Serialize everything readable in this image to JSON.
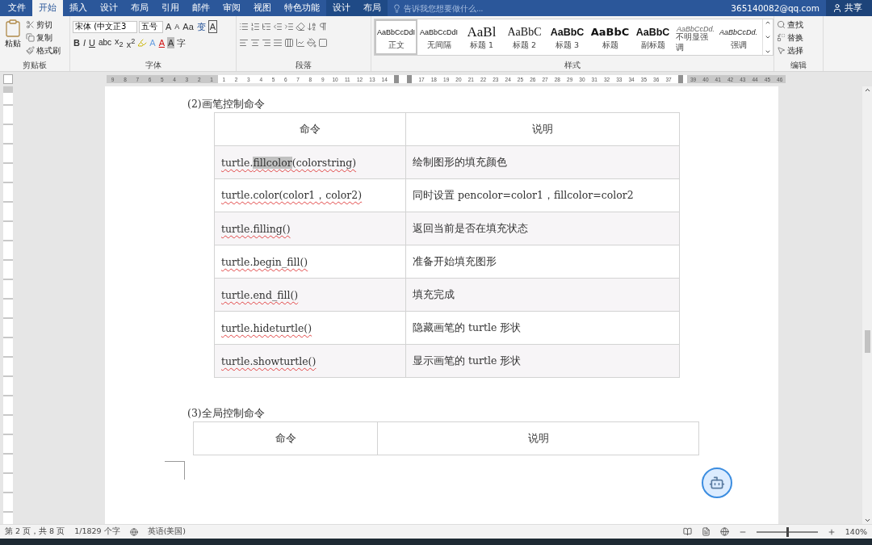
{
  "tabs": [
    {
      "label": "文件",
      "selected": false,
      "kind": "main"
    },
    {
      "label": "开始",
      "selected": true,
      "kind": "main"
    },
    {
      "label": "插入",
      "selected": false,
      "kind": "main"
    },
    {
      "label": "设计",
      "selected": false,
      "kind": "main"
    },
    {
      "label": "布局",
      "selected": false,
      "kind": "main"
    },
    {
      "label": "引用",
      "selected": false,
      "kind": "main"
    },
    {
      "label": "邮件",
      "selected": false,
      "kind": "main"
    },
    {
      "label": "审阅",
      "selected": false,
      "kind": "main"
    },
    {
      "label": "视图",
      "selected": false,
      "kind": "main"
    },
    {
      "label": "特色功能",
      "selected": false,
      "kind": "main"
    },
    {
      "label": "设计",
      "selected": false,
      "kind": "context"
    },
    {
      "label": "布局",
      "selected": false,
      "kind": "context"
    }
  ],
  "tell_me": {
    "placeholder": "告诉我您想要做什么..."
  },
  "account": "365140082@qq.com",
  "share": "共享",
  "clipboard": {
    "paste": "粘贴",
    "items": [
      "剪切",
      "复制",
      "格式刷"
    ],
    "label": "剪贴板"
  },
  "font": {
    "name": "宋体 (中文正3",
    "size": "五号",
    "row1": [
      "A",
      "A",
      "Aa",
      "变",
      "A"
    ],
    "row2": [
      "B",
      "I",
      "U",
      "abc",
      "x$_{2}$",
      "x$^{2}$"
    ],
    "row2b": [
      "A",
      "A",
      "A",
      "字"
    ],
    "label": "字体"
  },
  "paragraph": {
    "label": "段落"
  },
  "styles": {
    "label": "样式",
    "items": [
      {
        "preview": "AaBbCcDdI",
        "name": "正文",
        "selected": true,
        "kind": "body"
      },
      {
        "preview": "AaBbCcDdI",
        "name": "无间隔",
        "selected": false,
        "kind": "body"
      },
      {
        "preview": "AaBl",
        "name": "标题 1",
        "selected": false,
        "kind": "h1"
      },
      {
        "preview": "AaBbC",
        "name": "标题 2",
        "selected": false,
        "kind": "h2"
      },
      {
        "preview": "AaBbC",
        "name": "标题 3",
        "selected": false,
        "kind": "h3"
      },
      {
        "preview": "AaBbC",
        "name": "标题",
        "selected": false,
        "kind": "title"
      },
      {
        "preview": "AaBbC",
        "name": "副标题",
        "selected": false,
        "kind": "subtitle"
      },
      {
        "preview": "AaBbCcDd.",
        "name": "不明显强调",
        "selected": false,
        "kind": "subtle"
      },
      {
        "preview": "AaBbCcDd.",
        "name": "强调",
        "selected": false,
        "kind": "emphasis"
      }
    ]
  },
  "editing": {
    "label": "编辑",
    "items": [
      "查找",
      "替换",
      "选择"
    ]
  },
  "ruler": [
    {
      "label": "9",
      "kind": "margin"
    },
    {
      "label": "8",
      "kind": "margin"
    },
    {
      "label": "7",
      "kind": "margin"
    },
    {
      "label": "6",
      "kind": "margin"
    },
    {
      "label": "5",
      "kind": "margin"
    },
    {
      "label": "4",
      "kind": "margin"
    },
    {
      "label": "3",
      "kind": "margin"
    },
    {
      "label": "2",
      "kind": "margin"
    },
    {
      "label": "1",
      "kind": "margin"
    },
    {
      "label": "1",
      "kind": "text"
    },
    {
      "label": "2",
      "kind": "text"
    },
    {
      "label": "3",
      "kind": "text"
    },
    {
      "label": "4",
      "kind": "text"
    },
    {
      "label": "5",
      "kind": "text"
    },
    {
      "label": "6",
      "kind": "text"
    },
    {
      "label": "7",
      "kind": "text"
    },
    {
      "label": "8",
      "kind": "text"
    },
    {
      "label": "9",
      "kind": "text"
    },
    {
      "label": "10",
      "kind": "text"
    },
    {
      "label": "11",
      "kind": "text"
    },
    {
      "label": "12",
      "kind": "text"
    },
    {
      "label": "13",
      "kind": "text"
    },
    {
      "label": "14",
      "kind": "text"
    },
    {
      "kind": "marker"
    },
    {
      "kind": "marker"
    },
    {
      "label": "17",
      "kind": "text"
    },
    {
      "label": "18",
      "kind": "text"
    },
    {
      "label": "19",
      "kind": "text"
    },
    {
      "label": "20",
      "kind": "text"
    },
    {
      "label": "21",
      "kind": "text"
    },
    {
      "label": "22",
      "kind": "text"
    },
    {
      "label": "23",
      "kind": "text"
    },
    {
      "label": "24",
      "kind": "text"
    },
    {
      "label": "25",
      "kind": "text"
    },
    {
      "label": "26",
      "kind": "text"
    },
    {
      "label": "27",
      "kind": "text"
    },
    {
      "label": "28",
      "kind": "text"
    },
    {
      "label": "29",
      "kind": "text"
    },
    {
      "label": "30",
      "kind": "text"
    },
    {
      "label": "31",
      "kind": "text"
    },
    {
      "label": "32",
      "kind": "text"
    },
    {
      "label": "33",
      "kind": "text"
    },
    {
      "label": "34",
      "kind": "text"
    },
    {
      "label": "35",
      "kind": "text"
    },
    {
      "label": "36",
      "kind": "text"
    },
    {
      "label": "37",
      "kind": "text"
    },
    {
      "kind": "marker"
    },
    {
      "label": "39",
      "kind": "margin"
    },
    {
      "label": "40",
      "kind": "margin"
    },
    {
      "label": "41",
      "kind": "margin"
    },
    {
      "label": "42",
      "kind": "margin"
    },
    {
      "label": "43",
      "kind": "margin"
    },
    {
      "label": "44",
      "kind": "margin"
    },
    {
      "label": "45",
      "kind": "margin"
    },
    {
      "label": "46",
      "kind": "margin"
    }
  ],
  "document": {
    "heading1": "(2)画笔控制命令",
    "table1": {
      "columns": [
        "命令",
        "说明"
      ],
      "rows": [
        {
          "command": [
            {
              "text": "turtle.",
              "selected": false
            },
            {
              "text": "fillcolor",
              "selected": true
            },
            {
              "text": "(colorstring)",
              "selected": false
            }
          ],
          "description": "绘制图形的填充颜色"
        },
        {
          "command": [
            {
              "text": "turtle.color(color1，color2)",
              "selected": false
            }
          ],
          "description": "同时设置 pencolor=color1，fillcolor=color2"
        },
        {
          "command": [
            {
              "text": "turtle.filling()",
              "selected": false
            }
          ],
          "description": "返回当前是否在填充状态"
        },
        {
          "command": [
            {
              "text": "turtle.begin_fill()",
              "selected": false
            }
          ],
          "description": "准备开始填充图形"
        },
        {
          "command": [
            {
              "text": "turtle.end_fill()",
              "selected": false
            }
          ],
          "description": "填充完成"
        },
        {
          "command": [
            {
              "text": "turtle.hideturtle()",
              "selected": false
            }
          ],
          "description": "隐藏画笔的 turtle 形状"
        },
        {
          "command": [
            {
              "text": "turtle.showturtle()",
              "selected": false
            }
          ],
          "description": "显示画笔的 turtle 形状"
        }
      ]
    },
    "heading2": "(3)全局控制命令",
    "table2": {
      "columns": [
        "命令",
        "说明"
      ]
    }
  },
  "status_bar": {
    "page": "第 2 页，共 8 页",
    "words": "1/1829 个字",
    "language": "英语(美国)",
    "zoom": {
      "level": 0.5,
      "percent": "140%"
    }
  }
}
